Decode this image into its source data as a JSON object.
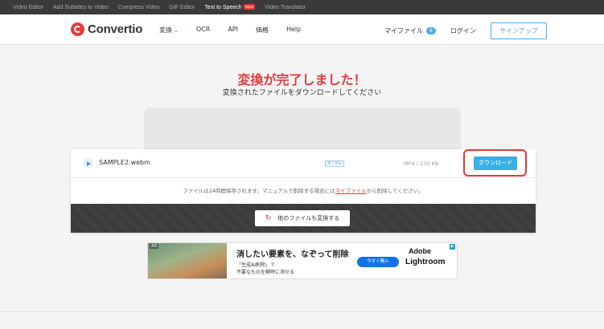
{
  "topbar": {
    "items": [
      {
        "label": "Video Editor"
      },
      {
        "label": "Add Subtitles to Video"
      },
      {
        "label": "Compress Video"
      },
      {
        "label": "GIF Editor"
      },
      {
        "label": "Text to Speech",
        "badge": "NEW"
      },
      {
        "label": "Video Translator"
      }
    ]
  },
  "header": {
    "brand": "Convertio",
    "nav": [
      "変換",
      "OCR",
      "API",
      "価格",
      "Help"
    ],
    "my_files": "マイファイル",
    "my_files_count": "6",
    "login": "ログイン",
    "signup": "サインアップ"
  },
  "result": {
    "headline": "変換が完了しました！",
    "subhead": "変換されたファイルをダウンロードしてください",
    "file_name": "SAMPLE2.webm",
    "tag": "完了済み",
    "file_meta": "MP4 / 230 KB",
    "download_label": "ダウンロード",
    "notice_before": "ファイルは24時間保存されます。マニュアルで削除する場合には",
    "notice_link": "マイファイル",
    "notice_after": "から削除してください。",
    "convert_more": "他のファイルも変換する"
  },
  "ad": {
    "label": "AD",
    "title": "消したい要素を、なぞって削除",
    "line1": "「生成AI削除」で",
    "line2": "不要なものを瞬時に消せる",
    "cta": "今すぐ購入",
    "brand1": "Adobe",
    "brand2": "Lightroom"
  },
  "colors": {
    "accent_red": "#e33b3b",
    "download_blue": "#3ab0e6",
    "highlight": "#e53935"
  }
}
